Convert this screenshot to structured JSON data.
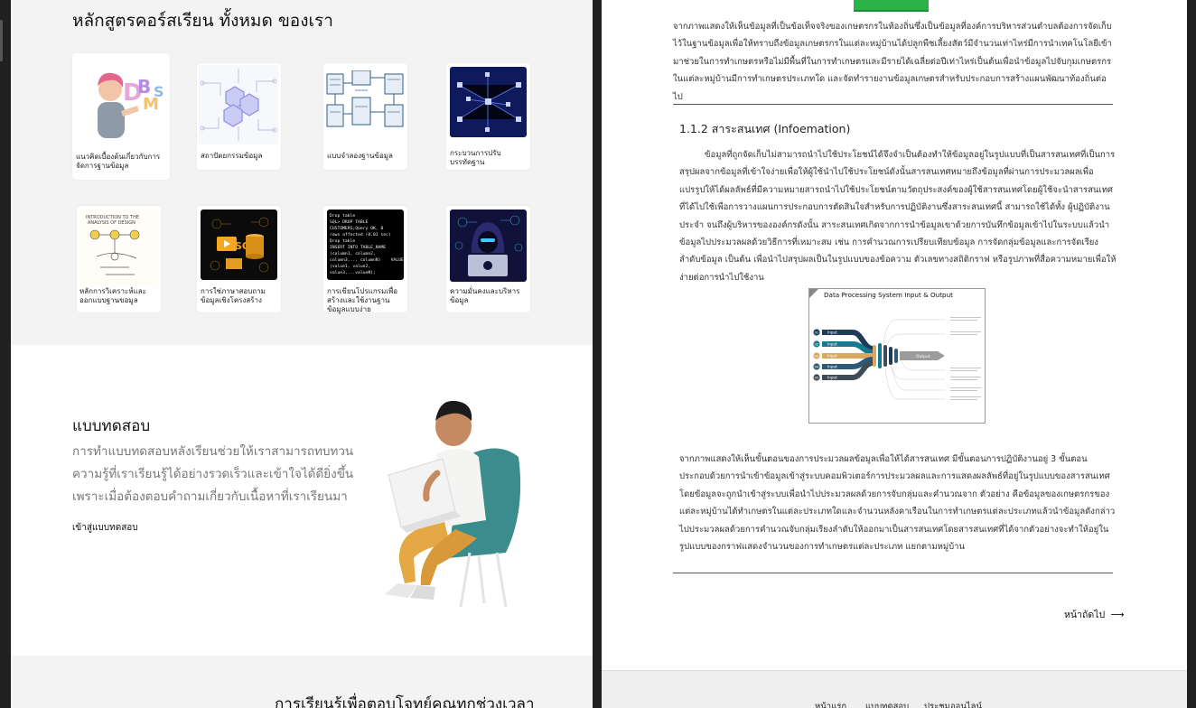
{
  "left": {
    "courses_title": "หลักสูตรคอร์สเรียน ทั้งหมด ของเรา",
    "cards": [
      {
        "caption": "แนวคิดเบื้องต้นเกี่ยวกับการจัดการฐานข้อมูล",
        "icon": "dbms-character-icon"
      },
      {
        "caption": "สถาปัตยกรรมข้อมูล",
        "icon": "circuit-hexagon-icon"
      },
      {
        "caption": "แบบจำลองฐานข้อมูล",
        "icon": "data-model-diagram-icon"
      },
      {
        "caption": "กระบวนการปรับบรรทัดฐาน",
        "icon": "network-cubes-icon"
      },
      {
        "caption": "หลักการวิเคราะห์และออกแบบฐานขอมูล",
        "icon": "analysis-sketch-icon"
      },
      {
        "caption": "การใช่ภาษาสอบถามข้อมูลเชิงโครงสร้าง",
        "icon": "sql-database-icon"
      },
      {
        "caption": "การเขียนโปรแกรมเพื่อสร้างและใช้งานฐานข้อมูลแบบง่าย",
        "icon": "sql-terminal-icon",
        "code": "Drop table\nSQL> DROP TABLE\nCUSTOMERS;Query OK, 0\nrows affected (0.01 sec)\nDrop table\nINSERT INTO TABLE_NAME\n(column1, column2,\ncolumn3,... columnN)    VALUES\n(value1, value2,\nvalue3,...valueN);"
      },
      {
        "caption": "ความมั่นคงและบริหารข้อมูล",
        "icon": "hacker-hood-icon"
      }
    ],
    "quiz_title": "แบบทดสอบ",
    "quiz_desc": "การทำแบบทดสอบหลังเรียนช่วยให้เราสามารถทบทวนความรู้ที่เราเรียนรู้ได้อย่างรวดเร็วและเข้าใจได้ดียิ่งขึ้นเพราะเมื่อต้องตอบคำถามเกี่ยวกับเนื้อหาที่เราเรียนมา",
    "quiz_link": "เข้าสู่แบบทดสอบ",
    "bottom_title": "การเรียนรู้เพื่อตอบโจทย์คุณทุกช่วงเวลา"
  },
  "right": {
    "para1": "จากภาพแสดงให้เห็นข้อมูลที่เป็นข้อเท็จจริงของเกษตรกรในท้องถิ่นซึ่งเป็นข้อมูลที่องค์การบริหารส่วนตำบลต้องการจัดเก็บไว้ในฐานข้อมูลเพื่อให้ทราบถึงข้อมูลเกษตรกรในแต่ละหมู่บ้านได้ปลูกพืชเลี้ยงสัตว์มีจำนวนเท่าไหร่มีการนำเทคโนโลยีเข้ามาช่วยในการทำเกษตรหรือไม่มีพื้นที่ในการทำเกษตรและมีรายได้เฉลี่ยต่อปีเท่าไหร่เป็นต้นเพื่อนำข้อมูลไปจับกุมเกษตรกรในแต่ละหมู่บ้านมีการทำเกษตรประเภทใด และจัดทำรายงานข้อมูลเกษตรสำหรับประกอบการสร้างแผนพัฒนาท้องถิ่นต่อไป",
    "subhead": "1.1.2 สาระสนเทศ (Infoemation)",
    "para2": "ข้อมูลที่ถูกจัดเก็บไม่สามารถนำไปใช้ประโยชน์ได้จึงจำเป็นต้องทำให้ข้อมูลอยู่ในรูปแบบที่เป็นสารสนเทศที่เป็นการสรุปผลจากข้อมูลที่เข้าใจง่ายเพื่อให้ผู้ใช้นำไปใช้ประโยชน์ดังนั้นสารสนเทศหมายถึงข้อมูลที่ผ่านการประมวลผลเพื่อแปรรูปให้ได้ผลลัพธ์ที่มีความหมายสารถนำไปใช้ประโยชน์ตามวัตถุประสงค์ของผู้ใช้สารสนเทศโดยผู้ใช้จะนำสารสนเทศที่ได้ไปใช้เพื่อการวางแผนการประกอบการตัดสินใจสำหรับการปฏิบัติงานซึ่งสาระสนเทศนี้ สามารถใช้ได้ทั้ง ผู้ปฏิบัติงานประจำ จนถึงผู้บริหารขององค์กรดังนั้น สาระสนเทศเกิดจากการนำข้อมูลเขาด้วยการบันทึกข้อมูลเข้าไปในระบบแล้วนำข้อมูลไปประมวลผลด้วยวิธีการที่เหมาะสม เช่น การคำนวณการเปรียบเทียบข้อมูล การจัดกลุ่มข้อมูลและการจัดเรียงลำดับข้อมูล เป็นต้น เพื่อนำไปสรุปผลเป็นในรูปแบบของข้อความ ตัวเลขทางสถิติกราฟ หรือรูปภาพที่สื่อความหมายเพื่อให้ง่ายต่อการนำไปใช้งาน",
    "figure_title": "Data Processing System Input & Output",
    "figure_input_label": "Input",
    "figure_output_label": "Output",
    "figure_numbers": [
      "01",
      "02",
      "03",
      "04",
      "05"
    ],
    "figure_colors": [
      "#1f3b5a",
      "#137a93",
      "#d9a760",
      "#2e5a7a",
      "#3f4b57"
    ],
    "para3": "จากภาพแสดงให้เห็นขั้นตอนของการประมวลผลข้อมูลเพื่อให้ได้สารสนเทศ มีขั้นตอนการปฏิบัติงานอยู่ 3 ขั้นตอนประกอบด้วยการนำเข้าข้อมูลเข้าสู่ระบบคอมพิวเตอร์การประมวลผลและการแสดงผลลัพธ์ที่อยู่ในรูปแบบของสารสนเทศโดยข้อมูลจะถูกนำเข้าสู่ระบบเพื่อนำไปประมวลผลด้วยการจับกลุ่มและคำนวณจาก ตัวอย่าง คือข้อมูลของเกษตรกรของแต่ละหมู่บ้านได้ทำเกษตรในแต่ละประเภทใดและจำนวนหลังคาเรือนในการทำเกษตรแต่ละประเภทแล้วนำข้อมูลดังกล่าวไปประมวลผลด้วยการคำนวณจับกลุ่มเรียงลำดับให้ออกมาเป็นสารสนเทศโดยสารสนเทศที่ได้จากตัวอย่างจะทำให้อยู่ในรูปแบบของกราฟแสดงจำนวนของการทำเกษตรแต่ละประเภท แยกตามหมู่บ้าน",
    "next_link": "หน้าถัดไป",
    "next_arrow": "⟶",
    "footer_links": [
      "หน้าแรก",
      "แบบทดสอบ",
      "ประชุมออนไลน์"
    ]
  }
}
